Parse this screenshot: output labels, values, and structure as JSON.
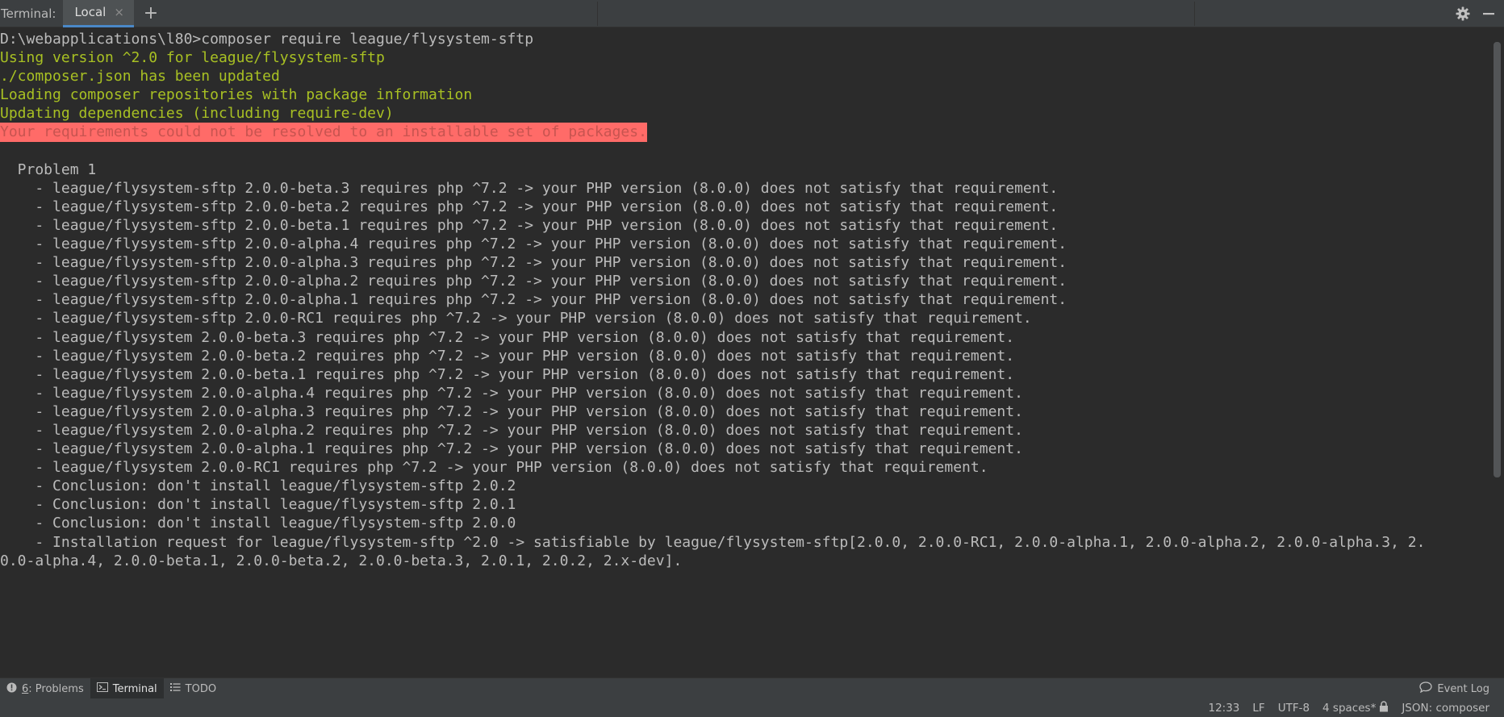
{
  "tabbar": {
    "title": "Terminal:",
    "active_tab": "Local",
    "close_glyph": "×",
    "add_glyph": "+",
    "icons": [
      "gear-icon",
      "minimize-icon"
    ]
  },
  "terminal": {
    "lines": [
      {
        "text": "D:\\webapplications\\l80>composer require league/flysystem-sftp",
        "style": "plain"
      },
      {
        "parts": [
          {
            "text": "Using version ",
            "style": "green"
          },
          {
            "text": "^2.0",
            "style": "green"
          },
          {
            "text": " for ",
            "style": "green"
          },
          {
            "text": "league/flysystem-sftp",
            "style": "green"
          }
        ]
      },
      {
        "text": "./composer.json has been updated",
        "style": "green"
      },
      {
        "text": "Loading composer repositories with package information",
        "style": "green"
      },
      {
        "text": "Updating dependencies (including require-dev)",
        "style": "green"
      },
      {
        "text": "Your requirements could not be resolved to an installable set of packages.",
        "style": "error"
      },
      {
        "text": "",
        "style": "plain"
      },
      {
        "text": "  Problem 1",
        "style": "plain"
      },
      {
        "text": "    - league/flysystem-sftp 2.0.0-beta.3 requires php ^7.2 -> your PHP version (8.0.0) does not satisfy that requirement.",
        "style": "plain"
      },
      {
        "text": "    - league/flysystem-sftp 2.0.0-beta.2 requires php ^7.2 -> your PHP version (8.0.0) does not satisfy that requirement.",
        "style": "plain"
      },
      {
        "text": "    - league/flysystem-sftp 2.0.0-beta.1 requires php ^7.2 -> your PHP version (8.0.0) does not satisfy that requirement.",
        "style": "plain"
      },
      {
        "text": "    - league/flysystem-sftp 2.0.0-alpha.4 requires php ^7.2 -> your PHP version (8.0.0) does not satisfy that requirement.",
        "style": "plain"
      },
      {
        "text": "    - league/flysystem-sftp 2.0.0-alpha.3 requires php ^7.2 -> your PHP version (8.0.0) does not satisfy that requirement.",
        "style": "plain"
      },
      {
        "text": "    - league/flysystem-sftp 2.0.0-alpha.2 requires php ^7.2 -> your PHP version (8.0.0) does not satisfy that requirement.",
        "style": "plain"
      },
      {
        "text": "    - league/flysystem-sftp 2.0.0-alpha.1 requires php ^7.2 -> your PHP version (8.0.0) does not satisfy that requirement.",
        "style": "plain"
      },
      {
        "text": "    - league/flysystem-sftp 2.0.0-RC1 requires php ^7.2 -> your PHP version (8.0.0) does not satisfy that requirement.",
        "style": "plain"
      },
      {
        "text": "    - league/flysystem 2.0.0-beta.3 requires php ^7.2 -> your PHP version (8.0.0) does not satisfy that requirement.",
        "style": "plain"
      },
      {
        "text": "    - league/flysystem 2.0.0-beta.2 requires php ^7.2 -> your PHP version (8.0.0) does not satisfy that requirement.",
        "style": "plain"
      },
      {
        "text": "    - league/flysystem 2.0.0-beta.1 requires php ^7.2 -> your PHP version (8.0.0) does not satisfy that requirement.",
        "style": "plain"
      },
      {
        "text": "    - league/flysystem 2.0.0-alpha.4 requires php ^7.2 -> your PHP version (8.0.0) does not satisfy that requirement.",
        "style": "plain"
      },
      {
        "text": "    - league/flysystem 2.0.0-alpha.3 requires php ^7.2 -> your PHP version (8.0.0) does not satisfy that requirement.",
        "style": "plain"
      },
      {
        "text": "    - league/flysystem 2.0.0-alpha.2 requires php ^7.2 -> your PHP version (8.0.0) does not satisfy that requirement.",
        "style": "plain"
      },
      {
        "text": "    - league/flysystem 2.0.0-alpha.1 requires php ^7.2 -> your PHP version (8.0.0) does not satisfy that requirement.",
        "style": "plain"
      },
      {
        "text": "    - league/flysystem 2.0.0-RC1 requires php ^7.2 -> your PHP version (8.0.0) does not satisfy that requirement.",
        "style": "plain"
      },
      {
        "text": "    - Conclusion: don't install league/flysystem-sftp 2.0.2",
        "style": "plain"
      },
      {
        "text": "    - Conclusion: don't install league/flysystem-sftp 2.0.1",
        "style": "plain"
      },
      {
        "text": "    - Conclusion: don't install league/flysystem-sftp 2.0.0",
        "style": "plain"
      },
      {
        "text": "    - Installation request for league/flysystem-sftp ^2.0 -> satisfiable by league/flysystem-sftp[2.0.0, 2.0.0-RC1, 2.0.0-alpha.1, 2.0.0-alpha.2, 2.0.0-alpha.3, 2.",
        "style": "plain"
      },
      {
        "text": "0.0-alpha.4, 2.0.0-beta.1, 2.0.0-beta.2, 2.0.0-beta.3, 2.0.1, 2.0.2, 2.x-dev].",
        "style": "plain"
      }
    ]
  },
  "toolwindows": {
    "problems_num": "6",
    "problems_label": ": Problems",
    "terminal_label": "Terminal",
    "todo_label": "TODO",
    "event_log_label": "Event Log"
  },
  "statusbar": {
    "time": "12:33",
    "line_sep": "LF",
    "encoding": "UTF-8",
    "indent": "4 spaces*",
    "schema": "JSON: composer"
  },
  "colors": {
    "background": "#2b2b2b",
    "green_text": "#a8c023",
    "error_bg": "#ff6b68",
    "accent": "#4a88c7"
  }
}
